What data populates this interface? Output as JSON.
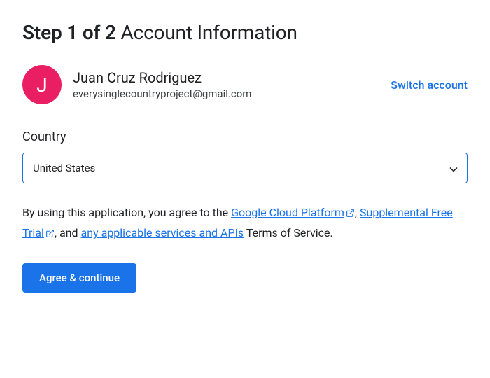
{
  "header": {
    "step_label": "Step 1 of 2",
    "title": "Account Information"
  },
  "account": {
    "avatar_letter": "J",
    "name": "Juan Cruz Rodriguez",
    "email": "everysinglecountryproject@gmail.com",
    "switch_label": "Switch account"
  },
  "country": {
    "label": "Country",
    "value": "United States"
  },
  "terms": {
    "prefix": "By using this application, you agree to the ",
    "link1": "Google Cloud Platform",
    "sep1": ", ",
    "link2": "Supplemental Free Trial",
    "sep2": ", and ",
    "link3": "any applicable services and APIs",
    "suffix": " Terms of Service."
  },
  "buttons": {
    "agree": "Agree & continue"
  },
  "colors": {
    "primary": "#1a73e8",
    "avatar_bg": "#e91e63"
  }
}
